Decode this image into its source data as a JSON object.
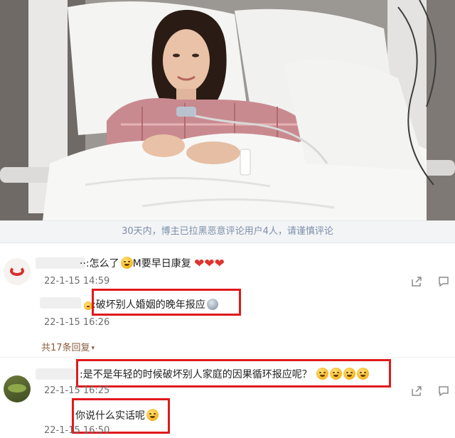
{
  "notice": {
    "text": "30天内，博主已拉黑恶意评论用户4人，请谨慎评论"
  },
  "comments": [
    {
      "text": "··:怎么了",
      "text_after": "M要早日康复",
      "time": "22-1-15 14:59",
      "emoji": "worried-face-emoji",
      "hearts": [
        "❤",
        "❤",
        "❤"
      ]
    },
    {
      "text": ":破坏别人婚姻的晚年报应",
      "time": "22-1-15 16:26",
      "replies_label": "共17条回复",
      "caret": "▾",
      "emoji": "grey-badge-emoji"
    },
    {
      "text": ":是不是年轻的时候破坏别人家庭的因果循环报应呢？",
      "time": "22-1-15 16:25",
      "emoji": "sleeping-face-emoji"
    },
    {
      "text": "你说什么实话呢",
      "time": "22-1-15 16:50",
      "emoji": "laughing-face-emoji"
    }
  ],
  "colors": {
    "highlight": "#e0191c",
    "notice_text": "#7c8fa8",
    "heart": "#e0342e",
    "replies": "#8a5a3a"
  },
  "icons": {
    "share": "share-icon",
    "comment": "comment-icon"
  }
}
